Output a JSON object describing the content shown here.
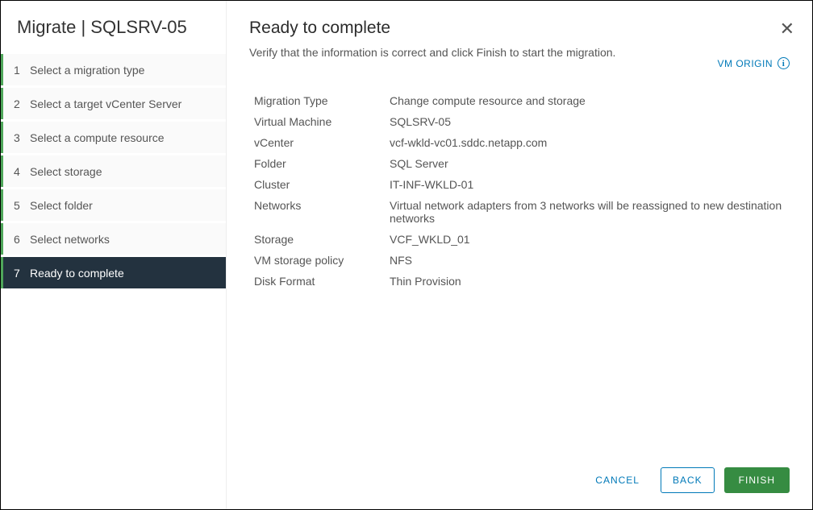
{
  "sidebar": {
    "title": "Migrate | SQLSRV-05",
    "steps": [
      {
        "num": "1",
        "label": "Select a migration type"
      },
      {
        "num": "2",
        "label": "Select a target vCenter Server"
      },
      {
        "num": "3",
        "label": "Select a compute resource"
      },
      {
        "num": "4",
        "label": "Select storage"
      },
      {
        "num": "5",
        "label": "Select folder"
      },
      {
        "num": "6",
        "label": "Select networks"
      },
      {
        "num": "7",
        "label": "Ready to complete"
      }
    ],
    "activeIndex": 6
  },
  "header": {
    "title": "Ready to complete",
    "subtitle": "Verify that the information is correct and click Finish to start the migration.",
    "vmOrigin": "VM ORIGIN"
  },
  "details": [
    {
      "label": "Migration Type",
      "value": "Change compute resource and storage"
    },
    {
      "label": "Virtual Machine",
      "value": "SQLSRV-05"
    },
    {
      "label": "vCenter",
      "value": "vcf-wkld-vc01.sddc.netapp.com"
    },
    {
      "label": "Folder",
      "value": "SQL Server"
    },
    {
      "label": "Cluster",
      "value": "IT-INF-WKLD-01"
    },
    {
      "label": "Networks",
      "value": "Virtual network adapters from 3 networks will be reassigned to new destination networks"
    },
    {
      "label": "Storage",
      "value": "VCF_WKLD_01"
    },
    {
      "label": "VM storage policy",
      "value": "NFS"
    },
    {
      "label": "Disk Format",
      "value": "Thin Provision"
    }
  ],
  "footer": {
    "cancel": "CANCEL",
    "back": "BACK",
    "finish": "FINISH"
  }
}
